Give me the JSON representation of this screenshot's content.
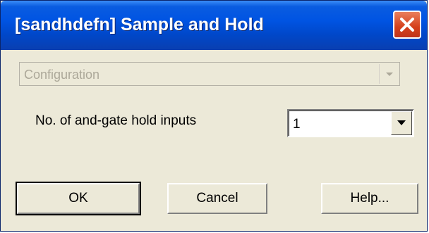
{
  "window": {
    "title": "[sandhdefn] Sample and Hold"
  },
  "config": {
    "selected": "Configuration"
  },
  "field": {
    "label": "No. of and-gate hold inputs",
    "value": "1"
  },
  "buttons": {
    "ok": "OK",
    "cancel": "Cancel",
    "help": "Help..."
  },
  "icons": {
    "close": "close-icon",
    "dropdown": "chevron-down-icon"
  },
  "colors": {
    "titlebar": "#0054e3",
    "close": "#d5401b",
    "dialog_bg": "#ece9d8"
  }
}
